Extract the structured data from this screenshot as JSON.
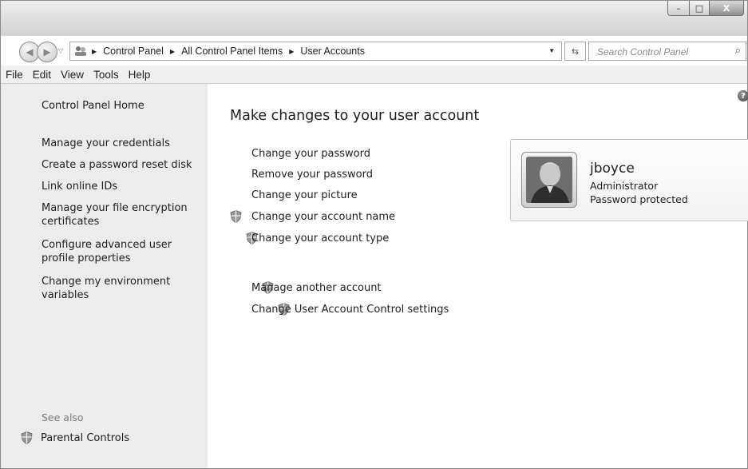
{
  "window": {
    "caption_buttons": {
      "minimize": "–",
      "maximize": "□",
      "close": "X"
    }
  },
  "address_bar": {
    "crumbs": [
      "Control Panel",
      "All Control Panel Items",
      "User Accounts"
    ],
    "search_placeholder": "Search Control Panel"
  },
  "menu": {
    "items": [
      "File",
      "Edit",
      "View",
      "Tools",
      "Help"
    ]
  },
  "sidebar": {
    "home": "Control Panel Home",
    "links": [
      "Manage your credentials",
      "Create a password reset disk",
      "Link online IDs",
      "Manage your file encryption certificates",
      "Configure advanced user profile properties",
      "Change my environment variables"
    ],
    "see_also_label": "See also",
    "see_also_items": [
      "Parental Controls"
    ]
  },
  "main": {
    "heading": "Make changes to your user account",
    "tasks": [
      {
        "label": "Change your password",
        "shield": false
      },
      {
        "label": "Remove your password",
        "shield": false
      },
      {
        "label": "Change your picture",
        "shield": false
      },
      {
        "label": "Change your account name",
        "shield": true
      },
      {
        "label": "Change your account type",
        "shield": true
      }
    ],
    "other_tasks": [
      {
        "label": "Manage another account",
        "shield": true
      },
      {
        "label": "Change User Account Control settings",
        "shield": true
      }
    ]
  },
  "user": {
    "name": "jboyce",
    "role": "Administrator",
    "status": "Password protected"
  },
  "icons": {
    "shield": "uac-shield-icon",
    "help": "help-icon",
    "search": "search-icon",
    "refresh": "refresh-icon"
  }
}
